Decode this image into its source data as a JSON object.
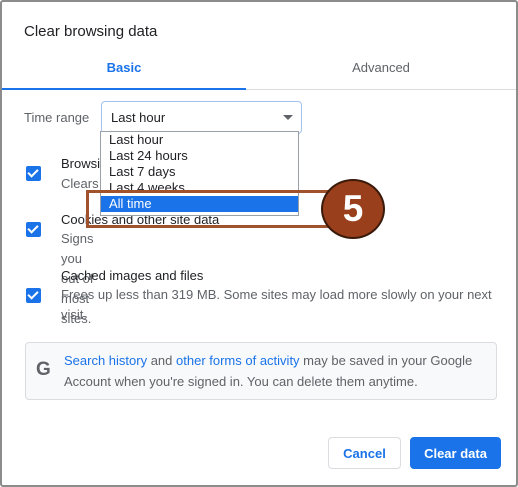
{
  "dialog": {
    "title": "Clear browsing data",
    "tabs": [
      {
        "label": "Basic",
        "active": true
      },
      {
        "label": "Advanced",
        "active": false
      }
    ],
    "time_range": {
      "label": "Time range",
      "selected": "Last hour",
      "options": [
        "Last hour",
        "Last 24 hours",
        "Last 7 days",
        "Last 4 weeks",
        "All time"
      ],
      "highlighted_option": "All time"
    },
    "options": [
      {
        "title": "Browsing history",
        "title_visible": "Browsin",
        "desc": "Clears history and autocompletions in the address bar",
        "desc_visible": "Clears",
        "checked": true
      },
      {
        "title": "Cookies and other site data",
        "desc": "Signs you out of most sites.",
        "checked": true
      },
      {
        "title": "Cached images and files",
        "desc": "Frees up less than 319 MB. Some sites may load more slowly on your next visit.",
        "checked": true
      }
    ],
    "google_notice": {
      "icon": "G",
      "link1": "Search history",
      "mid1": " and ",
      "link2": "other forms of activity",
      "rest": " may be saved in your Google Account when you're signed in. You can delete them anytime."
    },
    "buttons": {
      "cancel": "Cancel",
      "clear": "Clear data"
    }
  },
  "annotation": {
    "step_number": "5",
    "color": "#9a3f1c"
  },
  "colors": {
    "accent": "#1a73e8",
    "annotation": "#a0522d"
  }
}
